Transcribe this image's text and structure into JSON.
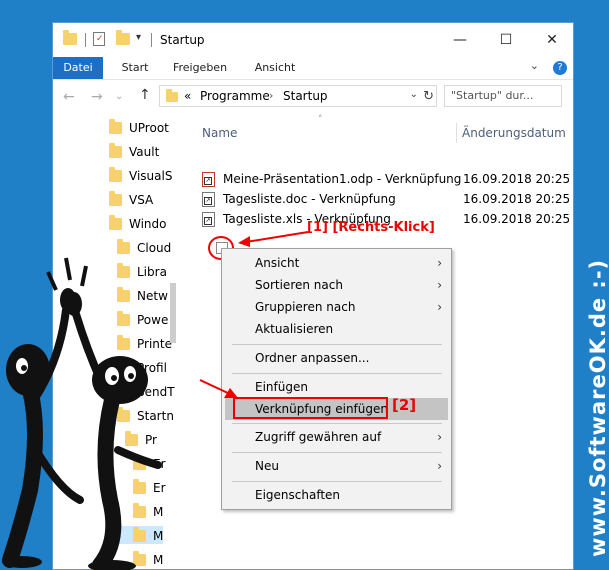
{
  "window": {
    "title": "Startup",
    "controls": {
      "minimize": "—",
      "maximize": "☐",
      "close": "✕"
    }
  },
  "ribbon": {
    "tabs": [
      "Datei",
      "Start",
      "Freigeben",
      "Ansicht"
    ]
  },
  "address": {
    "breadcrumb_prefix": "«",
    "crumbs": [
      "Programme",
      "Startup"
    ],
    "search_placeholder": "\"Startup\" dur..."
  },
  "nav_tree": [
    "UProot",
    "Vault",
    "VisualS",
    "VSA",
    "Windo",
    "Cloud",
    "Libra",
    "Netw",
    "Powe",
    "Printe",
    "Profil",
    "SendT",
    "Startn",
    "Pr",
    "Er",
    "Er",
    "M",
    "M",
    "M"
  ],
  "columns": {
    "name": "Name",
    "date": "Änderungsdatum"
  },
  "files": [
    {
      "name": "Meine-Präsentation1.odp - Verknüpfung",
      "date": "16.09.2018 20:25",
      "icon": "odp-shortcut-icon"
    },
    {
      "name": "Tagesliste.doc - Verknüpfung",
      "date": "16.09.2018 20:25",
      "icon": "doc-shortcut-icon"
    },
    {
      "name": "Tagesliste.xls - Verknüpfung",
      "date": "16.09.2018 20:25",
      "icon": "xls-shortcut-icon"
    }
  ],
  "context_menu": {
    "items": [
      {
        "label": "Ansicht",
        "submenu": true
      },
      {
        "label": "Sortieren nach",
        "submenu": true
      },
      {
        "label": "Gruppieren nach",
        "submenu": true
      },
      {
        "label": "Aktualisieren",
        "submenu": false
      },
      {
        "label": "Ordner anpassen...",
        "submenu": false
      },
      {
        "label": "Einfügen",
        "submenu": false
      },
      {
        "label": "Verknüpfung einfügen",
        "submenu": false,
        "highlighted": true
      },
      {
        "label": "Zugriff gewähren auf",
        "submenu": true
      },
      {
        "label": "Neu",
        "submenu": true
      },
      {
        "label": "Eigenschaften",
        "submenu": false
      }
    ]
  },
  "annotations": {
    "step1": "[1] [Rechts-Klick]",
    "step2": "[2]",
    "accent": "#e00000"
  },
  "watermark": "www.SoftwareOK.de :-)"
}
